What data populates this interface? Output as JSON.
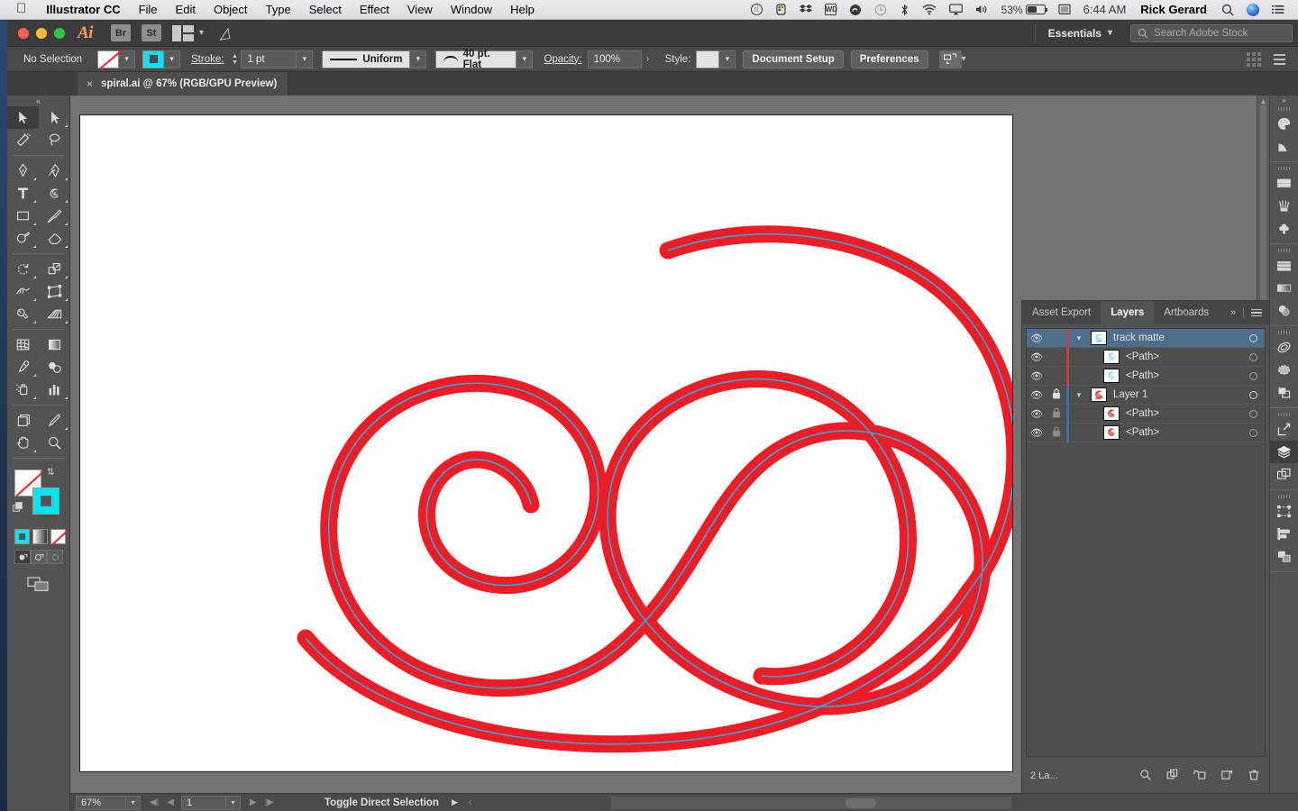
{
  "menubar": {
    "apple": "apple-logo",
    "items": [
      {
        "label": "Illustrator CC",
        "bold": true
      },
      {
        "label": "File",
        "bold": false
      },
      {
        "label": "Edit",
        "bold": false
      },
      {
        "label": "Object",
        "bold": false
      },
      {
        "label": "Type",
        "bold": false
      },
      {
        "label": "Select",
        "bold": false
      },
      {
        "label": "Effect",
        "bold": false
      },
      {
        "label": "View",
        "bold": false
      },
      {
        "label": "Window",
        "bold": false
      },
      {
        "label": "Help",
        "bold": false
      }
    ],
    "status": {
      "dashlane": "d",
      "colorsync": "colorsync-icon",
      "dropbox": "dropbox-icon",
      "wd": "WD",
      "creative_cloud": "creative-cloud-icon",
      "timemachine": "time-machine-icon",
      "bluetooth": "bluetooth-icon",
      "wifi": "wifi-icon",
      "airplay": "airplay-icon",
      "volume": "volume-icon",
      "battery_percent": "53%",
      "keyboard": "keyboard-input-icon",
      "time": "6:44 AM",
      "user": "Rick Gerard",
      "search": "spotlight-search-icon",
      "siri": "siri-icon",
      "notifications": "notification-center-icon"
    }
  },
  "titlebar": {
    "app_logo": "Ai",
    "bridge": "Br",
    "stock": "St",
    "arrange": "arrange-documents-icon",
    "rocket": "behance-publish-icon",
    "workspace": "Essentials",
    "search_placeholder": "Search Adobe Stock"
  },
  "controlbar": {
    "selection_status": "No Selection",
    "fill_swatch": "none-fill-swatch",
    "stroke_swatch": "cyan-stroke-swatch",
    "stroke_label": "Stroke:",
    "stroke_weight": "1 pt",
    "variable_width": "Uniform",
    "brush_definition": "40 pt. Flat",
    "opacity_label": "Opacity:",
    "opacity_value": "100%",
    "style_label": "Style:",
    "document_setup": "Document Setup",
    "preferences": "Preferences"
  },
  "tab": {
    "close": "×",
    "title": "spiral.ai @ 67% (RGB/GPU Preview)"
  },
  "toolbar": {
    "tools": [
      {
        "name": "selection-tool",
        "active": true
      },
      {
        "name": "direct-selection-tool",
        "active": false
      },
      {
        "name": "magic-wand-tool",
        "active": false
      },
      {
        "name": "lasso-tool",
        "active": false
      },
      {
        "name": "pen-tool",
        "active": false
      },
      {
        "name": "curvature-tool",
        "active": false
      },
      {
        "name": "type-tool",
        "active": false
      },
      {
        "name": "spiral-tool",
        "active": false
      },
      {
        "name": "rectangle-tool",
        "active": false
      },
      {
        "name": "paintbrush-tool",
        "active": false
      },
      {
        "name": "shaper-tool",
        "active": false
      },
      {
        "name": "eraser-tool",
        "active": false
      },
      {
        "name": "rotate-tool",
        "active": false
      },
      {
        "name": "scale-tool",
        "active": false
      },
      {
        "name": "width-tool",
        "active": false
      },
      {
        "name": "free-transform-tool",
        "active": false
      },
      {
        "name": "shape-builder-tool",
        "active": false
      },
      {
        "name": "perspective-grid-tool",
        "active": false
      },
      {
        "name": "mesh-tool",
        "active": false
      },
      {
        "name": "gradient-tool",
        "active": false
      },
      {
        "name": "eyedropper-tool",
        "active": false
      },
      {
        "name": "blend-tool",
        "active": false
      },
      {
        "name": "symbol-sprayer-tool",
        "active": false
      },
      {
        "name": "column-graph-tool",
        "active": false
      },
      {
        "name": "artboard-tool",
        "active": false
      },
      {
        "name": "slice-tool",
        "active": false
      },
      {
        "name": "hand-tool",
        "active": false
      },
      {
        "name": "zoom-tool",
        "active": false
      }
    ],
    "fill_color": "#ffffff",
    "fill_is_none": true,
    "stroke_color": "#00e5f0",
    "modes": [
      "color-mode",
      "gradient-mode",
      "none-mode"
    ],
    "draw_modes": [
      "draw-normal",
      "draw-behind",
      "draw-inside"
    ],
    "screen_mode": "change-screen-mode-icon"
  },
  "canvas": {
    "artboard_background": "#ffffff",
    "canvas_background": "#737373",
    "artwork": {
      "stroke_red": "#ee1c25",
      "path_cyan": "#29abe2",
      "description": "double-spiral-artwork"
    }
  },
  "statusbar": {
    "zoom": "67%",
    "page": "1",
    "status_text": "Toggle Direct Selection"
  },
  "layers_panel": {
    "tabs": [
      {
        "label": "Asset Export",
        "active": false
      },
      {
        "label": "Layers",
        "active": true
      },
      {
        "label": "Artboards",
        "active": false
      }
    ],
    "expand_icon": "»",
    "menu_icon": "panel-menu-icon",
    "rows": [
      {
        "name": "track matte",
        "type": "layer",
        "selected": true,
        "visible": true,
        "locked": false,
        "expanded": true,
        "color": "#ee3124",
        "thumb": "cyan",
        "indent": 0,
        "target": "circle"
      },
      {
        "name": "<Path>",
        "type": "path",
        "selected": false,
        "visible": true,
        "locked": false,
        "expanded": false,
        "color": "#ee3124",
        "thumb": "cyan",
        "indent": 1,
        "target": "circle-dim"
      },
      {
        "name": "<Path>",
        "type": "path",
        "selected": false,
        "visible": true,
        "locked": false,
        "expanded": false,
        "color": "#ee3124",
        "thumb": "cyan",
        "indent": 1,
        "target": "circle-dim"
      },
      {
        "name": "Layer 1",
        "type": "layer",
        "selected": false,
        "visible": true,
        "locked": true,
        "expanded": true,
        "color": "#2f6fd0",
        "thumb": "red",
        "indent": 0,
        "target": "circle"
      },
      {
        "name": "<Path>",
        "type": "path",
        "selected": false,
        "visible": true,
        "locked": true,
        "expanded": false,
        "color": "#2f6fd0",
        "thumb": "red",
        "indent": 1,
        "target": "circle-dim"
      },
      {
        "name": "<Path>",
        "type": "path",
        "selected": false,
        "visible": true,
        "locked": true,
        "expanded": false,
        "color": "#2f6fd0",
        "thumb": "red",
        "indent": 1,
        "target": "circle-dim"
      }
    ],
    "footer": {
      "count": "2 La...",
      "locate_object": "locate-object-icon",
      "make_subset": "collect-for-export-icon",
      "create_sublayer": "create-new-sublayer-icon",
      "create_layer": "create-new-layer-icon",
      "delete": "delete-selection-icon"
    }
  },
  "dock": {
    "groups": [
      {
        "items": [
          {
            "name": "color-panel-icon",
            "active": false
          },
          {
            "name": "color-guide-panel-icon",
            "active": false
          }
        ]
      },
      {
        "items": [
          {
            "name": "swatches-panel-icon",
            "active": false
          },
          {
            "name": "brushes-panel-icon",
            "active": false
          },
          {
            "name": "symbols-panel-icon",
            "active": false
          }
        ]
      },
      {
        "items": [
          {
            "name": "stroke-panel-icon",
            "active": false
          },
          {
            "name": "gradient-panel-icon",
            "active": false
          },
          {
            "name": "transparency-panel-icon",
            "active": false
          }
        ]
      },
      {
        "items": [
          {
            "name": "libraries-panel-icon",
            "active": false
          },
          {
            "name": "image-trace-panel-icon",
            "active": false
          },
          {
            "name": "pathfinder-panel-icon",
            "active": false
          }
        ]
      },
      {
        "items": [
          {
            "name": "asset-export-panel-icon",
            "active": false
          },
          {
            "name": "layers-panel-icon",
            "active": true
          },
          {
            "name": "artboards-panel-icon",
            "active": false
          }
        ]
      },
      {
        "items": [
          {
            "name": "transform-panel-icon",
            "active": false
          },
          {
            "name": "align-panel-icon",
            "active": false
          },
          {
            "name": "arrange-panel-icon",
            "active": false
          }
        ]
      }
    ]
  }
}
